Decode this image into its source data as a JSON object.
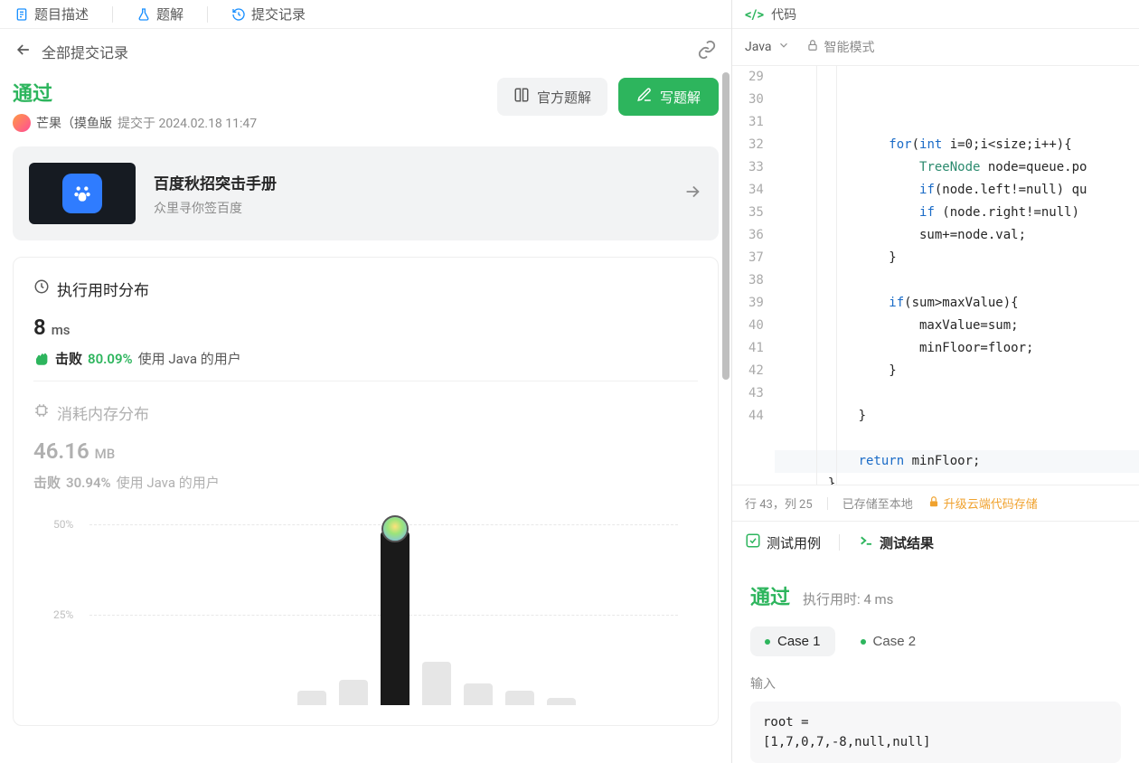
{
  "top_tabs": {
    "desc": "题目描述",
    "solution": "题解",
    "history": "提交记录"
  },
  "back_label": "全部提交记录",
  "status": {
    "pass": "通过",
    "user": "芒果（摸鱼版",
    "submitted": "提交于 2024.02.18 11:47"
  },
  "buttons": {
    "official": "官方题解",
    "write": "写题解"
  },
  "promo": {
    "title": "百度秋招突击手册",
    "sub": "众里寻你签百度"
  },
  "runtime": {
    "head": "执行用时分布",
    "value": "8",
    "unit": "ms",
    "beat_label": "击败",
    "beat_pct": "80.09%",
    "beat_suffix": "使用 Java 的用户"
  },
  "memory": {
    "head": "消耗内存分布",
    "value": "46.16",
    "unit": "MB",
    "beat_label": "击败",
    "beat_pct": "30.94%",
    "beat_suffix": "使用 Java 的用户"
  },
  "chart_data": {
    "type": "bar",
    "ylabel": "percent",
    "ylim": [
      0,
      55
    ],
    "gridlines": [
      25,
      50
    ],
    "categories": [
      "b1",
      "b2",
      "b3",
      "b4",
      "b5",
      "b6",
      "b7"
    ],
    "values": [
      4,
      7,
      48,
      12,
      6,
      4,
      2
    ],
    "highlight_index": 2,
    "y_tick_labels": [
      "25%",
      "50%"
    ]
  },
  "code": {
    "title": "代码",
    "lang": "Java",
    "mode": "智能模式",
    "start_line": 29,
    "lines": [
      "               for(int i=0;i<size;i++){",
      "                   TreeNode node=queue.po",
      "                   if(node.left!=null) qu",
      "                   if (node.right!=null)",
      "                   sum+=node.val;",
      "               }",
      "",
      "               if(sum>maxValue){",
      "                   maxValue=sum;",
      "                   minFloor=floor;",
      "               }",
      "",
      "           }",
      "",
      "           return minFloor;",
      "       }"
    ],
    "highlight_line": 43
  },
  "editor_foot": {
    "pos": "行 43，列 25",
    "saved": "已存储至本地",
    "upgrade": "升级云端代码存储"
  },
  "test": {
    "tab_cases": "测试用例",
    "tab_result": "测试结果",
    "pass": "通过",
    "time_label": "执行用时: 4 ms",
    "case1": "Case 1",
    "case2": "Case 2",
    "input_label": "输入",
    "input_var": "root =",
    "input_val": "[1,7,0,7,-8,null,null]"
  }
}
